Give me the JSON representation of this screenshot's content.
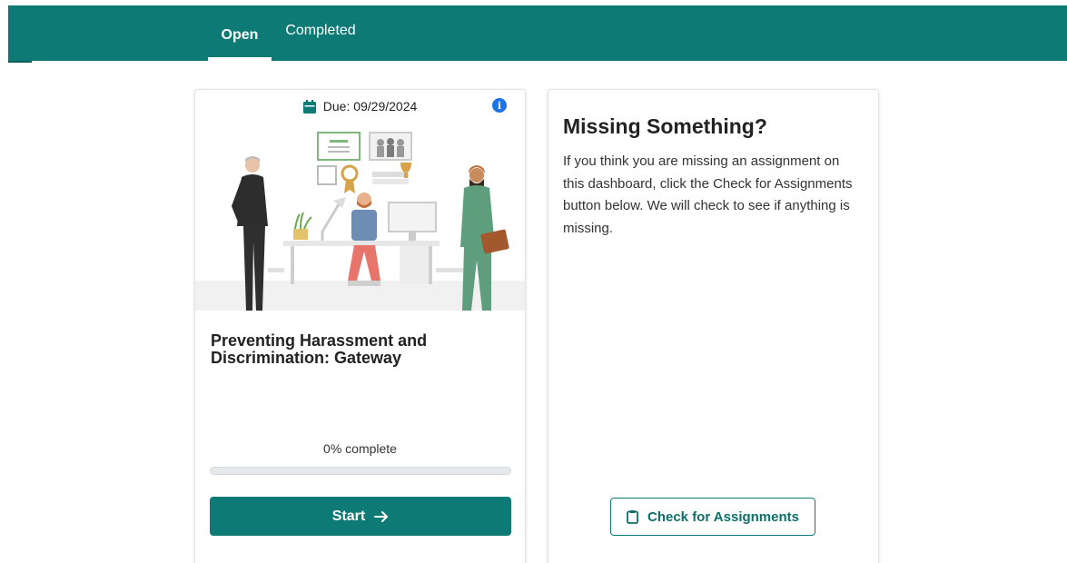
{
  "tabs": [
    {
      "label": "Open",
      "active": true
    },
    {
      "label": "Completed",
      "active": false
    }
  ],
  "colors": {
    "brand": "#0e7a76",
    "info": "#1a73e8"
  },
  "assignment": {
    "due_text": "Due: 09/29/2024",
    "due_icon": "calendar-icon",
    "info_icon": "info-icon",
    "info_glyph": "i",
    "title": "Preventing Harassment and Discrimination: Gateway",
    "progress_text": "0% complete",
    "progress_percent": 0,
    "start_label": "Start",
    "start_icon": "arrow-right-icon"
  },
  "missing": {
    "title": "Missing Something?",
    "body": "If you think you are missing an assignment on this dashboard, click the Check for Assignments button below. We will check to see if anything is missing.",
    "button_label": "Check for Assignments",
    "button_icon": "clipboard-icon"
  }
}
